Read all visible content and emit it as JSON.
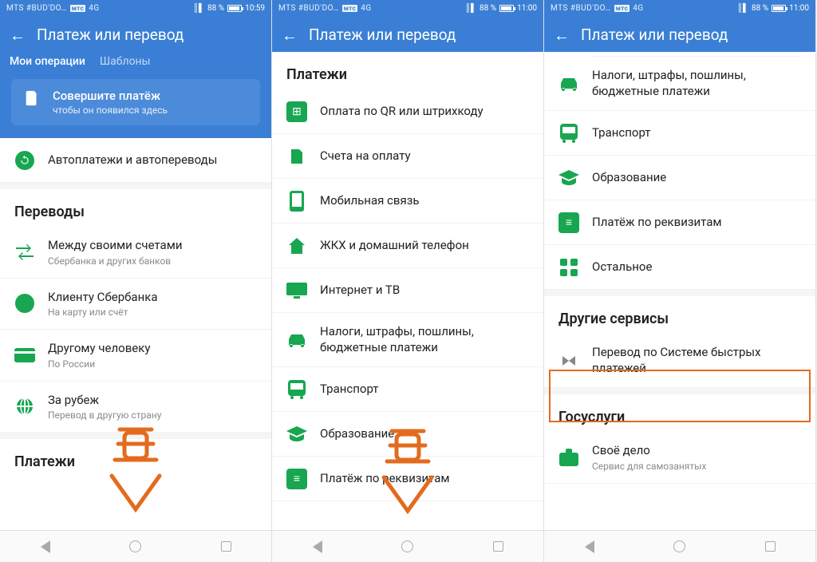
{
  "statusbar": {
    "carrier": "MTS #BUD'DO…",
    "badge": "мтс",
    "net": "4G",
    "battery": "88 %",
    "time1": "10:59",
    "time2": "11:00",
    "time3": "11:00"
  },
  "header": {
    "title": "Платеж или перевод"
  },
  "tabs": {
    "my_ops": "Мои операции",
    "templates": "Шаблоны"
  },
  "promo": {
    "title": "Совершите платёж",
    "sub": "чтобы он появился здесь"
  },
  "screen1": {
    "autopay": "Автоплатежи и автопереводы",
    "section_transfers": "Переводы",
    "t1": {
      "label": "Между своими счетами",
      "sub": "Сбербанка и других банков"
    },
    "t2": {
      "label": "Клиенту Сбербанка",
      "sub": "На карту или счёт"
    },
    "t3": {
      "label": "Другому человеку",
      "sub": "По России"
    },
    "t4": {
      "label": "За рубеж",
      "sub": "Перевод в другую страну"
    },
    "section_payments": "Платежи"
  },
  "screen2": {
    "section_payments": "Платежи",
    "p1": "Оплата по QR или штрихкоду",
    "p2": "Счета на оплату",
    "p3": "Мобильная связь",
    "p4": "ЖКХ и домашний телефон",
    "p5": "Интернет и ТВ",
    "p6": "Налоги, штрафы, пошлины, бюджетные платежи",
    "p7": "Транспорт",
    "p8": "Образование",
    "p9": "Платёж по реквизитам"
  },
  "screen3": {
    "p6": "Налоги, штрафы, пошлины, бюджетные платежи",
    "p7": "Транспорт",
    "p8": "Образование",
    "p9": "Платёж по реквизитам",
    "p10": "Остальное",
    "section_other": "Другие сервисы",
    "sbp": {
      "label": "Перевод по Системе быстрых платежей"
    },
    "section_gos": "Госуслуги",
    "gos1": {
      "label": "Своё дело",
      "sub": "Сервис для самозанятых"
    }
  }
}
